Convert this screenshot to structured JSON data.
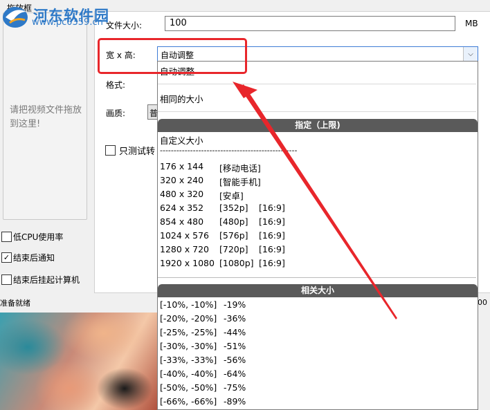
{
  "watermark": {
    "name": "河东软件园",
    "url": "www.pc0359.cn"
  },
  "window": {
    "frame_title": "拖放框"
  },
  "drop_zone": {
    "text": "请把视频文件拖放到这里!"
  },
  "options": {
    "low_cpu": {
      "label": "低CPU使用率",
      "checked": false
    },
    "notify": {
      "label": "结束后通知",
      "checked": true
    },
    "hibernate": {
      "label": "结束后挂起计算机",
      "checked": false
    }
  },
  "form": {
    "file_size_label": "文件大小:",
    "file_size_value": "100",
    "file_size_unit": "MB",
    "wh_label": "宽 x 高:",
    "wh_value": "自动调整",
    "format_label": "格式:",
    "quality_label": "画质:",
    "quality_value": "普",
    "test_label": "只测试转"
  },
  "status": {
    "text": "准备就绪",
    "right_fragment": "00"
  },
  "dropdown": {
    "auto_option": "自动调整",
    "same_option": "相同的大小",
    "group_specified": "指定（上限)",
    "custom_option": "自定义大小",
    "divider_text": "--------------------------------------------------",
    "sizes": [
      {
        "res": "176 x 144",
        "tag": "[移动电话]",
        "ratio": ""
      },
      {
        "res": "320 x 240",
        "tag": "[智能手机]",
        "ratio": ""
      },
      {
        "res": "480 x 320",
        "tag": "[安卓]",
        "ratio": ""
      },
      {
        "res": "624 x 352",
        "tag": "[352p]",
        "ratio": "[16:9]"
      },
      {
        "res": "854 x 480",
        "tag": "[480p]",
        "ratio": "[16:9]"
      },
      {
        "res": "1024 x 576",
        "tag": "[576p]",
        "ratio": "[16:9]"
      },
      {
        "res": "1280 x 720",
        "tag": "[720p]",
        "ratio": "[16:9]"
      },
      {
        "res": "1920 x 1080",
        "tag": "[1080p]",
        "ratio": "[16:9]"
      }
    ],
    "group_relative": "相关大小",
    "relative": [
      {
        "range": "[-10%, -10%]",
        "pct": "-19%"
      },
      {
        "range": "[-20%, -20%]",
        "pct": "-36%"
      },
      {
        "range": "[-25%, -25%]",
        "pct": "-44%"
      },
      {
        "range": "[-30%, -30%]",
        "pct": "-51%"
      },
      {
        "range": "[-33%, -33%]",
        "pct": "-56%"
      },
      {
        "range": "[-40%, -40%]",
        "pct": "-64%"
      },
      {
        "range": "[-50%, -50%]",
        "pct": "-75%"
      },
      {
        "range": "[-66%, -66%]",
        "pct": "-89%"
      }
    ]
  },
  "colors": {
    "annotation_red": "#e8262b",
    "header_gray": "#5a5a5a",
    "logo_blue": "#2e79c7"
  }
}
